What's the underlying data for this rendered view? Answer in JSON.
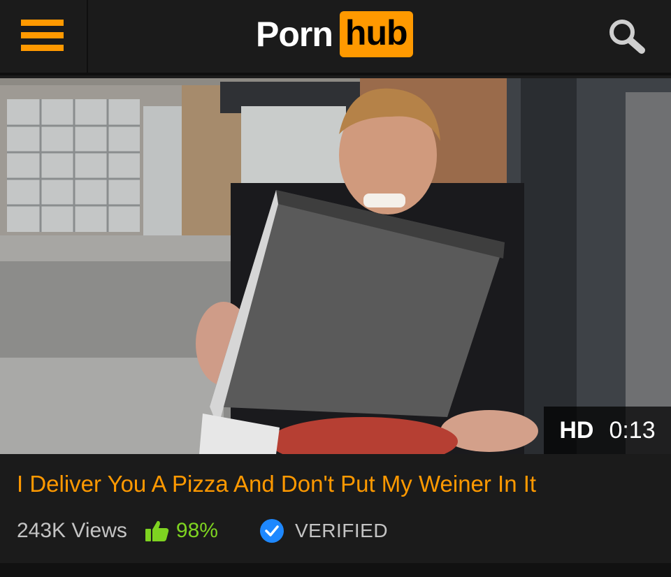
{
  "header": {
    "logo_left": "Porn",
    "logo_right": "hub",
    "menu_icon": "hamburger-menu-icon",
    "search_icon": "search-icon",
    "accent_color": "#ff9900"
  },
  "video": {
    "quality_badge": "HD",
    "duration": "0:13",
    "thumbnail": "man-holding-pizza-box-thumbnail"
  },
  "listing": {
    "title": "I Deliver You A Pizza And Don't Put My Weiner In It",
    "views": "243K Views",
    "rating": "98%",
    "rating_icon": "thumbs-up-icon",
    "verified_label": "VERIFIED",
    "verified_icon": "verified-check-icon",
    "title_color": "#ff9900",
    "rating_color": "#7ed321",
    "verified_color": "#1e88ff"
  }
}
